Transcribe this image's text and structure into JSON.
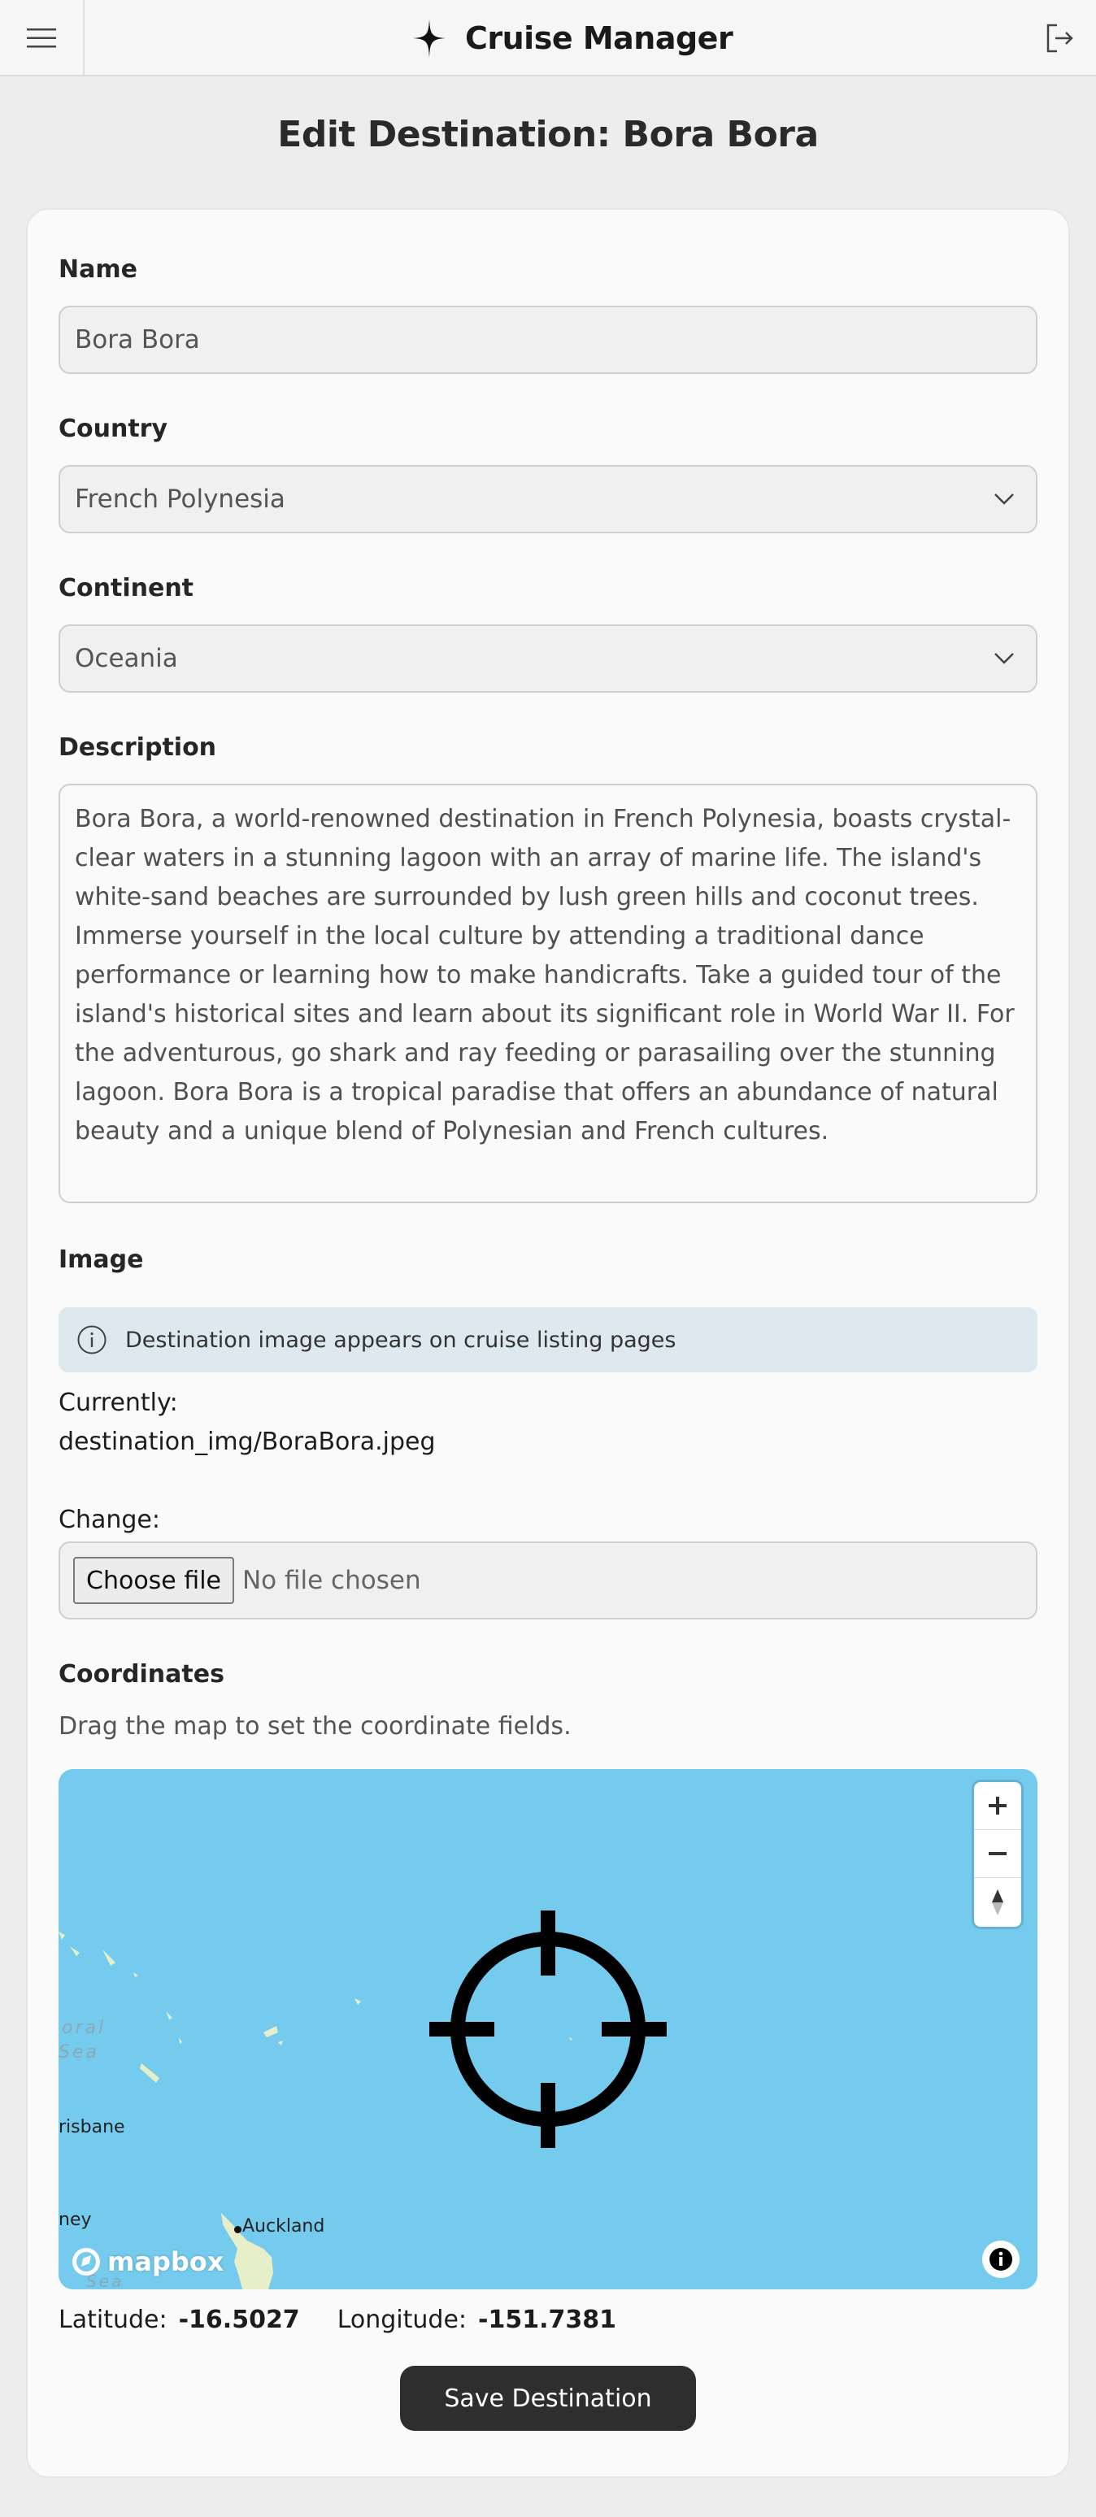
{
  "header": {
    "app_title": "Cruise Manager",
    "menu_icon": "hamburger-menu-icon",
    "logo_icon": "four-point-star-icon",
    "logout_icon": "logout-icon"
  },
  "page": {
    "title": "Edit Destination: Bora Bora"
  },
  "form": {
    "name": {
      "label": "Name",
      "value": "Bora Bora"
    },
    "country": {
      "label": "Country",
      "value": "French Polynesia"
    },
    "continent": {
      "label": "Continent",
      "value": "Oceania"
    },
    "description": {
      "label": "Description",
      "value": "Bora Bora, a world-renowned destination in French Polynesia, boasts crystal-clear waters in a stunning lagoon with an array of marine life. The island's white-sand beaches are surrounded by lush green hills and coconut trees. Immerse yourself in the local culture by attending a traditional dance performance or learning how to make handicrafts. Take a guided tour of the island's historical sites and learn about its significant role in World War II. For the adventurous, go shark and ray feeding or parasailing over the stunning lagoon. Bora Bora is a tropical paradise that offers an abundance of natural beauty and a unique blend of Polynesian and French cultures."
    },
    "image": {
      "label": "Image",
      "info": "Destination image appears on cruise listing pages",
      "currently_label": "Currently:",
      "current_file": "destination_img/BoraBora.jpeg",
      "change_label": "Change:",
      "choose_button": "Choose file",
      "file_status": "No file chosen"
    },
    "coordinates": {
      "label": "Coordinates",
      "hint": "Drag the map to set the coordinate fields.",
      "latitude_label": "Latitude:",
      "latitude": "-16.5027",
      "longitude_label": "Longitude:",
      "longitude": "-151.7381"
    },
    "save_button": "Save Destination"
  },
  "map": {
    "labels": {
      "coral_sea_1": "oral",
      "coral_sea_2": "Sea",
      "brisbane": "risbane",
      "sydney": "ney",
      "auckland": "Auckland",
      "bottom_sea": "Sea"
    },
    "logo_text": "mapbox",
    "colors": {
      "water": "#74cbed",
      "land": "#e7efc9"
    }
  }
}
